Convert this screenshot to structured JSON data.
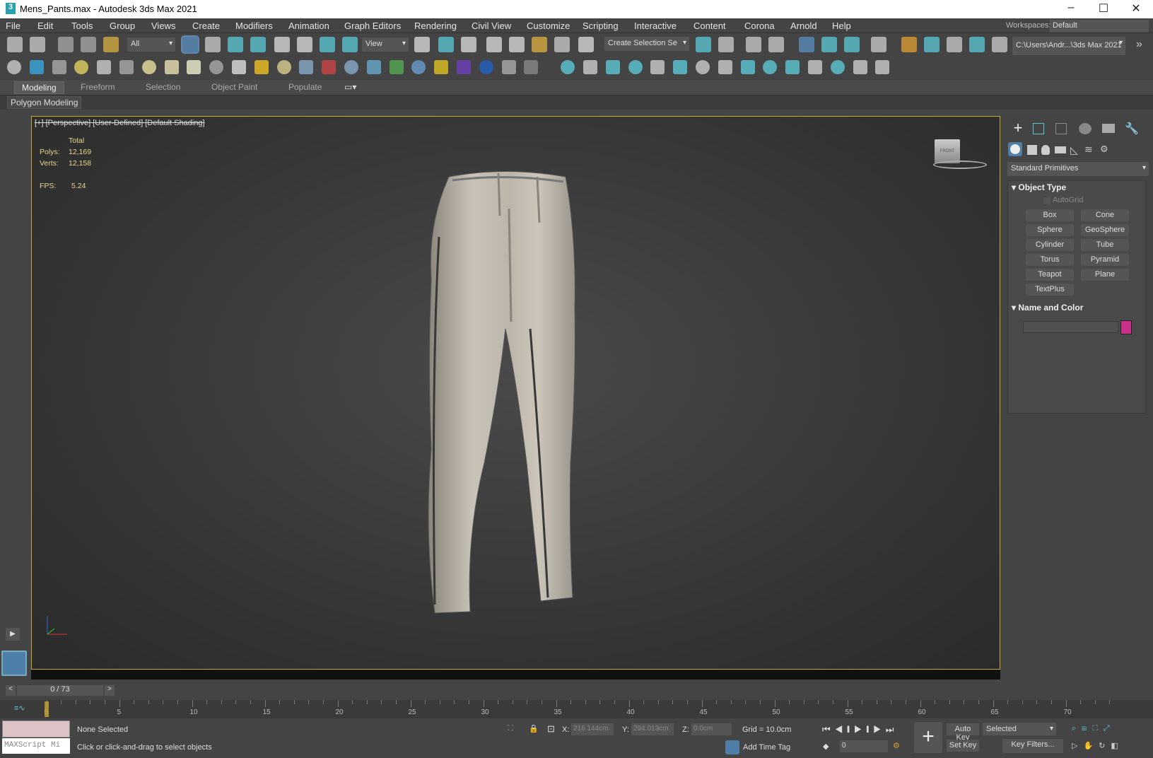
{
  "window": {
    "title": "Mens_Pants.max - Autodesk 3ds Max 2021",
    "app_icon": "3"
  },
  "menu": [
    "File",
    "Edit",
    "Tools",
    "Group",
    "Views",
    "Create",
    "Modifiers",
    "Animation",
    "Graph Editors",
    "Rendering",
    "Civil View",
    "Customize",
    "Scripting",
    "Interactive",
    "Content",
    "Corona",
    "Arnold",
    "Help"
  ],
  "workspaces": {
    "label": "Workspaces:",
    "value": "Default"
  },
  "toolbar1": {
    "filter": "All",
    "coord": "View",
    "selection_set": "Create Selection Se",
    "project_path": "C:\\Users\\Andr...\\3ds Max 2021"
  },
  "ribbon": {
    "tabs": [
      "Modeling",
      "Freeform",
      "Selection",
      "Object Paint",
      "Populate"
    ],
    "panel": "Polygon Modeling"
  },
  "viewport": {
    "label": "[+] [Perspective] [User-Defined] [Default Shading]",
    "stats": {
      "total": "Total",
      "polys_label": "Polys:",
      "polys": "12,169",
      "verts_label": "Verts:",
      "verts": "12,158",
      "fps_label": "FPS:",
      "fps": "5.24"
    },
    "viewcube": "FRONT"
  },
  "command_panel": {
    "category": "Standard Primitives",
    "object_type": "Object Type",
    "autogrid": "AutoGrid",
    "buttons": [
      "Box",
      "Cone",
      "Sphere",
      "GeoSphere",
      "Cylinder",
      "Tube",
      "Torus",
      "Pyramid",
      "Teapot",
      "Plane",
      "TextPlus"
    ],
    "name_and_color": "Name and Color",
    "object_color": "#c8308a"
  },
  "time": {
    "slider": "0 / 73",
    "ticks": [
      "0",
      "5",
      "10",
      "15",
      "20",
      "25",
      "30",
      "35",
      "40",
      "45",
      "50",
      "55",
      "60",
      "65",
      "70"
    ],
    "frames": 73
  },
  "status": {
    "maxscript": "MAXScript Mi",
    "selection": "None Selected",
    "prompt": "Click or click-and-drag to select objects",
    "x_label": "X:",
    "x": "216.144cm",
    "y_label": "Y:",
    "y": "294.013cm",
    "z_label": "Z:",
    "z": "0.0cm",
    "grid": "Grid = 10.0cm",
    "add_time_tag": "Add Time Tag",
    "auto_key": "Auto Key",
    "set_key": "Set Key",
    "key_mode": "Selected",
    "key_filters": "Key Filters...",
    "frame": "0"
  },
  "icons1": [
    "undo-icon",
    "redo-icon",
    "link-icon",
    "unlink-icon",
    "bind-space-warp-icon",
    "select-object-icon",
    "select-by-name-icon",
    "rect-selection-icon",
    "window-crossing-icon",
    "move-icon",
    "rotate-icon",
    "scale-icon",
    "placement-icon",
    "pivot-icon",
    "snap-icon",
    "keyboard-shortcut-icon",
    "snap-3d-icon",
    "angle-snap-icon",
    "percent-snap-icon",
    "spinner-snap-icon",
    "edit-named-sets-icon",
    "mirror-icon",
    "align-icon",
    "scene-explorer-icon",
    "layer-explorer-icon",
    "toggle-ribbon-icon",
    "curve-editor-icon",
    "dope-sheet-icon",
    "material-editor-icon",
    "render-setup-icon",
    "rendered-frame-icon",
    "render-icon",
    "render-cloud-icon",
    "a360-icon"
  ],
  "icons2": [
    "teapot-icon",
    "arnold-icon",
    "render-view-icon",
    "light-icon",
    "camera-tool-icon",
    "camera-icon",
    "plane-icon",
    "dome-icon",
    "sphere-icon",
    "teapot2-icon",
    "cone-icon",
    "sun-icon",
    "ball-icon",
    "grid-icon",
    "molecule-icon",
    "tower-icon",
    "gear-icon",
    "grass-icon",
    "sphere-blue-icon",
    "dots-icon",
    "purple-icon",
    "render-region-icon",
    "clipboard-icon",
    "help-icon",
    "bulb-icon",
    "sun2-icon",
    "video-icon",
    "trees-icon",
    "book-icon",
    "tree-icon",
    "tree2-icon",
    "refresh-icon",
    "capture-icon",
    "frame-icon",
    "play-frame-icon",
    "camera2-icon",
    "window-icon",
    "teapot3-icon",
    "bulb2-icon"
  ],
  "accent": "#5bc8d6"
}
